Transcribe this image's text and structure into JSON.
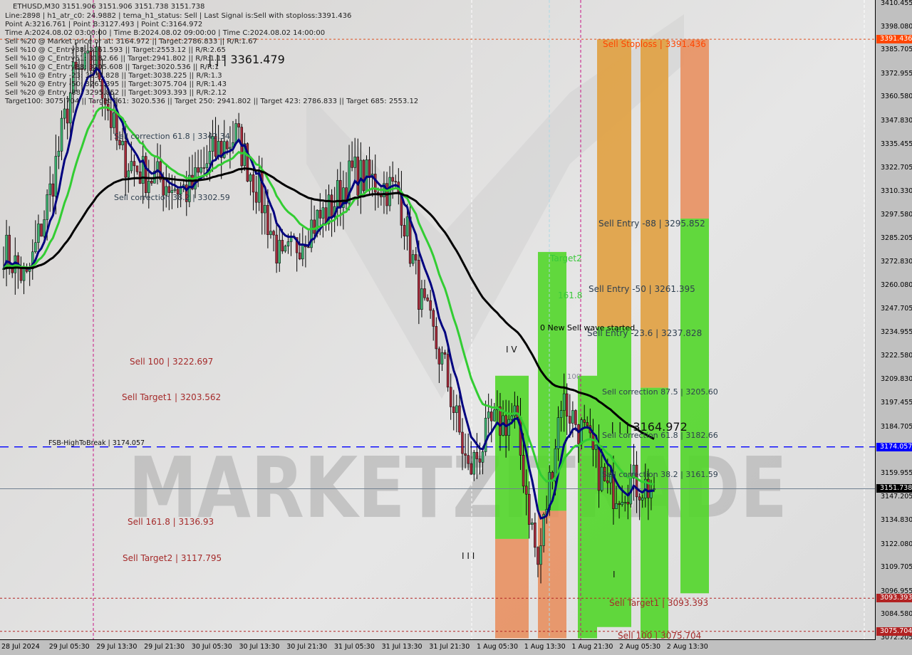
{
  "header": {
    "title": "ETHUSD,M30  3151.906 3151.906 3151.738 3151.738",
    "lines": [
      "Line:2898 | h1_atr_c0: 24.9882 | tema_h1_status: Sell | Last Signal is:Sell with stoploss:3391.436",
      "Point A:3216.761 | Point B:3127.493 | Point C:3164.972",
      "Time A:2024.08.02 03:00:00 | Time B:2024.08.02 09:00:00 | Time C:2024.08.02 14:00:00",
      "Sell %20 @ Market price or at: 3164.972 || Target:2786.833 || R/R:1.67",
      "Sell %10 @ C_Entry38: 3161.593 || Target:2553.12 || R/R:2.65",
      "Sell %10 @ C_Entry61: 3182.66 || Target:2941.802 || R/R:1.15",
      "Sell %10 @ C_Entry88: 3205.608 || Target:3020.536 || R/R:1",
      "Sell %10 @ Entry -23: 3237.828 || Target:3038.225 || R/R:1.3",
      "Sell %20 @ Entry -50: 3261.395 || Target:3075.704 || R/R:1.43",
      "Sell %20 @ Entry -88: 3295.852 || Target:3093.393 || R/R:2.12",
      "Target100: 3075.704 || Target 161: 3020.536 || Target 250: 2941.802 || Target 423: 2786.833 || Target 685: 2553.12"
    ]
  },
  "annotations": {
    "high_marker": "| | | 3361.479",
    "c_marker": "| | | 3164.972",
    "sell_corr_618_left": "Sell correction 61.8 | 3342.34",
    "sell_corr_382_left": "Sell correction 38.2 | 3302.59",
    "sell_100": "Sell 100 | 3222.697",
    "sell_target1_left": "Sell Target1 | 3203.562",
    "fsb": "FSB-HighToBreak | 3174.057",
    "sell_1618": "Sell 161.8 | 3136.93",
    "sell_target2": "Sell Target2 | 3117.795",
    "stoploss": "Sell Stoploss | 3391.436",
    "entry88": "Sell Entry -88 | 3295.852",
    "entry50": "Sell Entry -50 | 3261.395",
    "entry236": "Sell Entry -23.6 | 3237.828",
    "target2": "Target2",
    "t1618": "161.8",
    "new_wave": "0 New Sell wave started",
    "wave_iv": "I V",
    "wave_iii": "I I I",
    "wave_i": "I",
    "t100": "100",
    "corr875": "Sell correction 87.5 | 3205.60",
    "corr618": "Sell correction 61.8 | 3182.66",
    "corr382": "Sell correction 38.2 | 3161.59",
    "sell_target1": "Sell Target1 | 3093.393",
    "sell_100_right": "Sell 100 | 3075.704",
    "watermark": "MARKETZITRADE"
  },
  "chart_data": {
    "type": "candlestick",
    "symbol": "ETHUSD",
    "timeframe": "M30",
    "ylim": [
      3072.205,
      3410.455
    ],
    "y_ticks": [
      "3410.455",
      "3398.080",
      "3385.705",
      "3372.955",
      "3360.580",
      "3347.830",
      "3335.455",
      "3322.705",
      "3310.330",
      "3297.580",
      "3285.205",
      "3272.830",
      "3260.080",
      "3247.705",
      "3234.955",
      "3222.580",
      "3209.830",
      "3197.455",
      "3184.705",
      "3159.955",
      "3147.205",
      "3134.830",
      "3122.080",
      "3109.705",
      "3096.955",
      "3084.580",
      "3072.205"
    ],
    "x_ticks": [
      "28 Jul 2024",
      "29 Jul 05:30",
      "29 Jul 13:30",
      "29 Jul 21:30",
      "30 Jul 05:30",
      "30 Jul 13:30",
      "30 Jul 21:30",
      "31 Jul 05:30",
      "31 Jul 13:30",
      "31 Jul 21:30",
      "1 Aug 05:30",
      "1 Aug 13:30",
      "1 Aug 21:30",
      "2 Aug 05:30",
      "2 Aug 13:30"
    ],
    "close_approx_4h": [
      3280,
      3262,
      3310,
      3370,
      3380,
      3330,
      3320,
      3315,
      3310,
      3330,
      3340,
      3310,
      3270,
      3290,
      3300,
      3320,
      3315,
      3310,
      3250,
      3215,
      3160,
      3185,
      3190,
      3110,
      3200,
      3180,
      3150,
      3155,
      3151.738
    ],
    "price_tags": [
      {
        "label": "3391.436",
        "color": "#ff4500"
      },
      {
        "label": "3174.057",
        "color": "#0000ff"
      },
      {
        "label": "3151.738",
        "color": "#000000"
      },
      {
        "label": "3093.393",
        "color": "#b22222"
      },
      {
        "label": "3075.704",
        "color": "#b22222"
      }
    ],
    "colors": {
      "bull": "#3cb371",
      "bear": "#a52a3a",
      "ema_fast": "#00007f",
      "ema_mid": "#32cd32",
      "ema_slow": "#000000",
      "zone_green": "#52d62a",
      "zone_orange": "#e0a040",
      "zone_salmon": "#e89060"
    }
  }
}
